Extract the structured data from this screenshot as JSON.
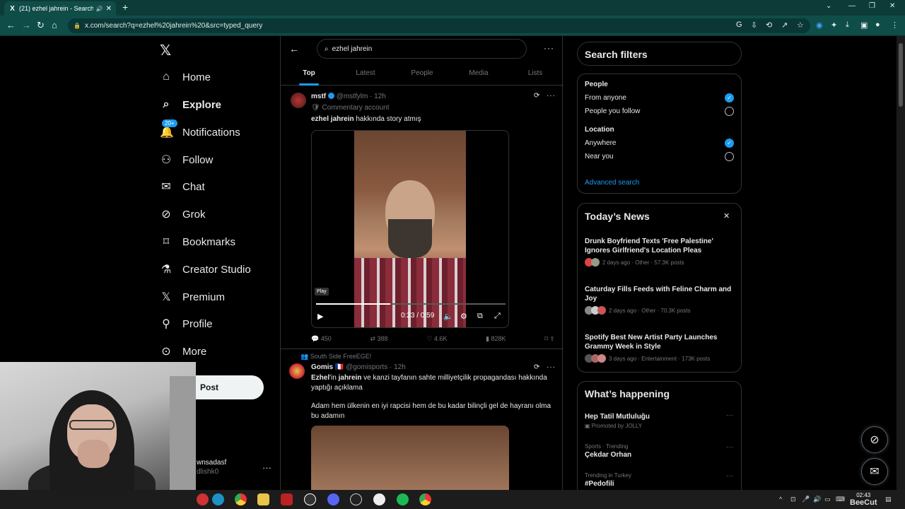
{
  "browser": {
    "tab_title": "(21) ezhel jahrein - Search / X",
    "tab_favicon": "X",
    "url": "x.com/search?q=ezhel%20jahrein%20&src=typed_query"
  },
  "nav": {
    "items": [
      {
        "label": "Home",
        "icon": "home-icon"
      },
      {
        "label": "Explore",
        "icon": "search-icon"
      },
      {
        "label": "Notifications",
        "icon": "bell-icon",
        "badge": "20+"
      },
      {
        "label": "Follow",
        "icon": "add-person-icon"
      },
      {
        "label": "Chat",
        "icon": "mail-icon"
      },
      {
        "label": "Grok",
        "icon": "grok-icon"
      },
      {
        "label": "Bookmarks",
        "icon": "bookmark-icon"
      },
      {
        "label": "Creator Studio",
        "icon": "flask-icon"
      },
      {
        "label": "Premium",
        "icon": "x-icon"
      },
      {
        "label": "Profile",
        "icon": "person-icon"
      },
      {
        "label": "More",
        "icon": "more-circle-icon"
      }
    ],
    "post_label": "Post",
    "account_name": "wnsadasf",
    "account_handle": "dlishk0"
  },
  "search": {
    "query": "ezhel jahrein",
    "tabs": [
      "Top",
      "Latest",
      "People",
      "Media",
      "Lists"
    ],
    "active_tab": "Top"
  },
  "tweets": [
    {
      "name": "mstf",
      "handle": "@mstfylm",
      "time": "12h",
      "label": "Commentary account",
      "text_bold": "ezhel jahrein",
      "text": " hakkında story atmış",
      "video": {
        "tooltip": "Play",
        "time": "0:23 / 0:59",
        "progress": 0.39
      },
      "replies": "450",
      "reposts": "388",
      "likes": "4.6K",
      "views": "828K"
    },
    {
      "context": "South Side FreeEGE!",
      "name": "Gomis",
      "flag": "🇫🇷",
      "handle": "@gomisports",
      "time": "12h",
      "text_bold1": "Ezhel",
      "text_part1": "'in ",
      "text_bold2": "jahrein",
      "text_part2": " ve kanzi tayfanın sahte milliyetçilik propagandası hakkında yaptığı açıklama",
      "text_line2": "Adam hem ülkenin en iyi rapcisi hem de bu kadar bilinçli gel de hayranı olma bu adamın"
    }
  ],
  "filters": {
    "title": "Search filters",
    "people_label": "People",
    "from_anyone": "From anyone",
    "people_you_follow": "People you follow",
    "location_label": "Location",
    "anywhere": "Anywhere",
    "near_you": "Near you",
    "advanced": "Advanced search"
  },
  "news": {
    "title": "Today’s News",
    "items": [
      {
        "headline": "Drunk Boyfriend Texts 'Free Palestine' Ignores Girlfriend's Location Pleas",
        "meta": "2 days ago · Other · 57.3K posts"
      },
      {
        "headline": "Caturday Fills Feeds with Feline Charm and Joy",
        "meta": "2 days ago · Other · 70.3K posts"
      },
      {
        "headline": "Spotify Best New Artist Party Launches Grammy Week in Style",
        "meta": "3 days ago · Entertainment · 173K posts"
      }
    ]
  },
  "happening": {
    "title": "What’s happening",
    "items": [
      {
        "category": "",
        "name": "Hep Tatil Mutluluğu",
        "promo": "Promoted by JOLLY"
      },
      {
        "category": "Sports · Trending",
        "name": "Çekdar Orhan",
        "promo": ""
      },
      {
        "category": "Trending in Turkey",
        "name": "#Pedofili",
        "promo": ""
      }
    ]
  },
  "taskbar": {
    "time": "02:43",
    "date": "",
    "watermark": "BeeCut"
  },
  "colors": {
    "accent": "#1d9bf0",
    "chrome": "#0f4d49",
    "background": "#000000"
  }
}
